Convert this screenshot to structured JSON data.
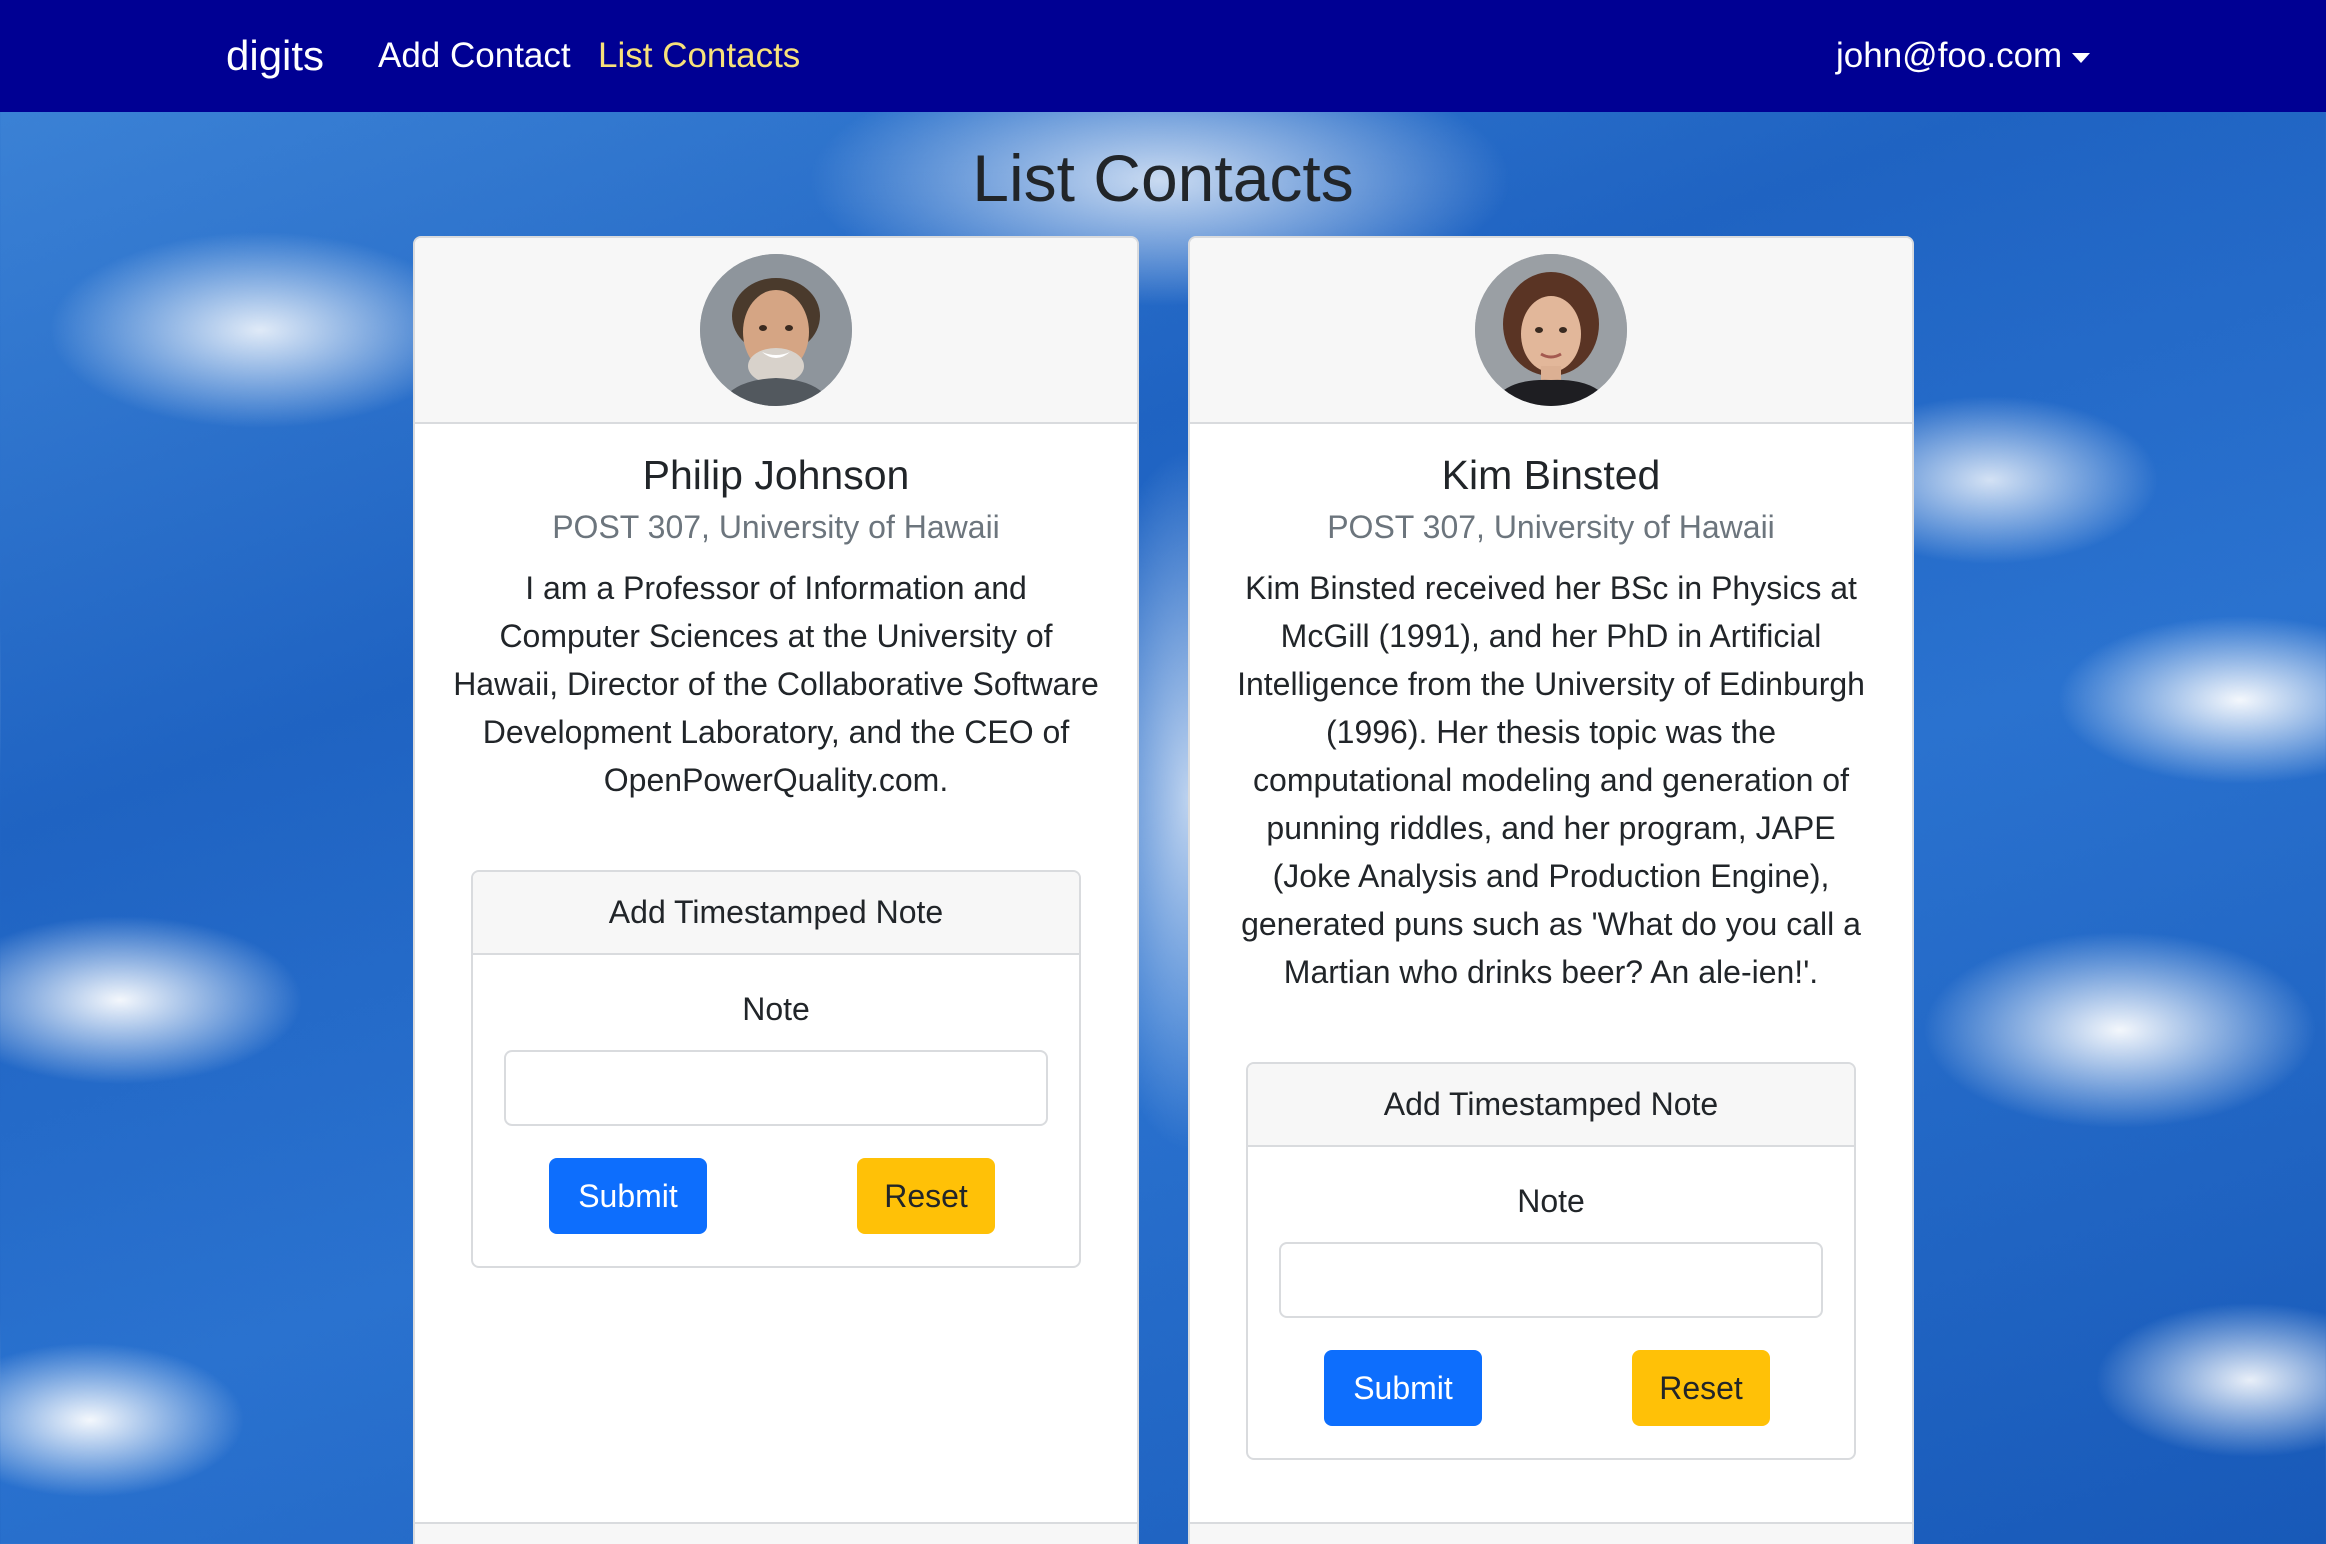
{
  "navbar": {
    "brand": "digits",
    "links": [
      {
        "label": "Add Contact",
        "active": false
      },
      {
        "label": "List Contacts",
        "active": true
      }
    ],
    "user": "john@foo.com",
    "background_color": "#000093",
    "active_link_color": "#f7e17a"
  },
  "page": {
    "title": "List Contacts"
  },
  "contacts": [
    {
      "name": "Philip Johnson",
      "address": "POST 307, University of Hawaii",
      "description": "I am a Professor of Information and Computer Sciences at the University of Hawaii, Director of the Collaborative Software Development Laboratory, and the CEO of OpenPowerQuality.com.",
      "avatar_icon": "man-portrait"
    },
    {
      "name": "Kim Binsted",
      "address": "POST 307, University of Hawaii",
      "description": "Kim Binsted received her BSc in Physics at McGill (1991), and her PhD in Artificial Intelligence from the University of Edinburgh (1996). Her thesis topic was the computational modeling and generation of punning riddles, and her program, JAPE (Joke Analysis and Production Engine), generated puns such as 'What do you call a Martian who drinks beer? An ale-ien!'.",
      "avatar_icon": "woman-portrait"
    }
  ],
  "note_form": {
    "header": "Add Timestamped Note",
    "label": "Note",
    "value": "",
    "submit_label": "Submit",
    "reset_label": "Reset",
    "submit_color": "#0d6efd",
    "reset_color": "#ffc107"
  }
}
